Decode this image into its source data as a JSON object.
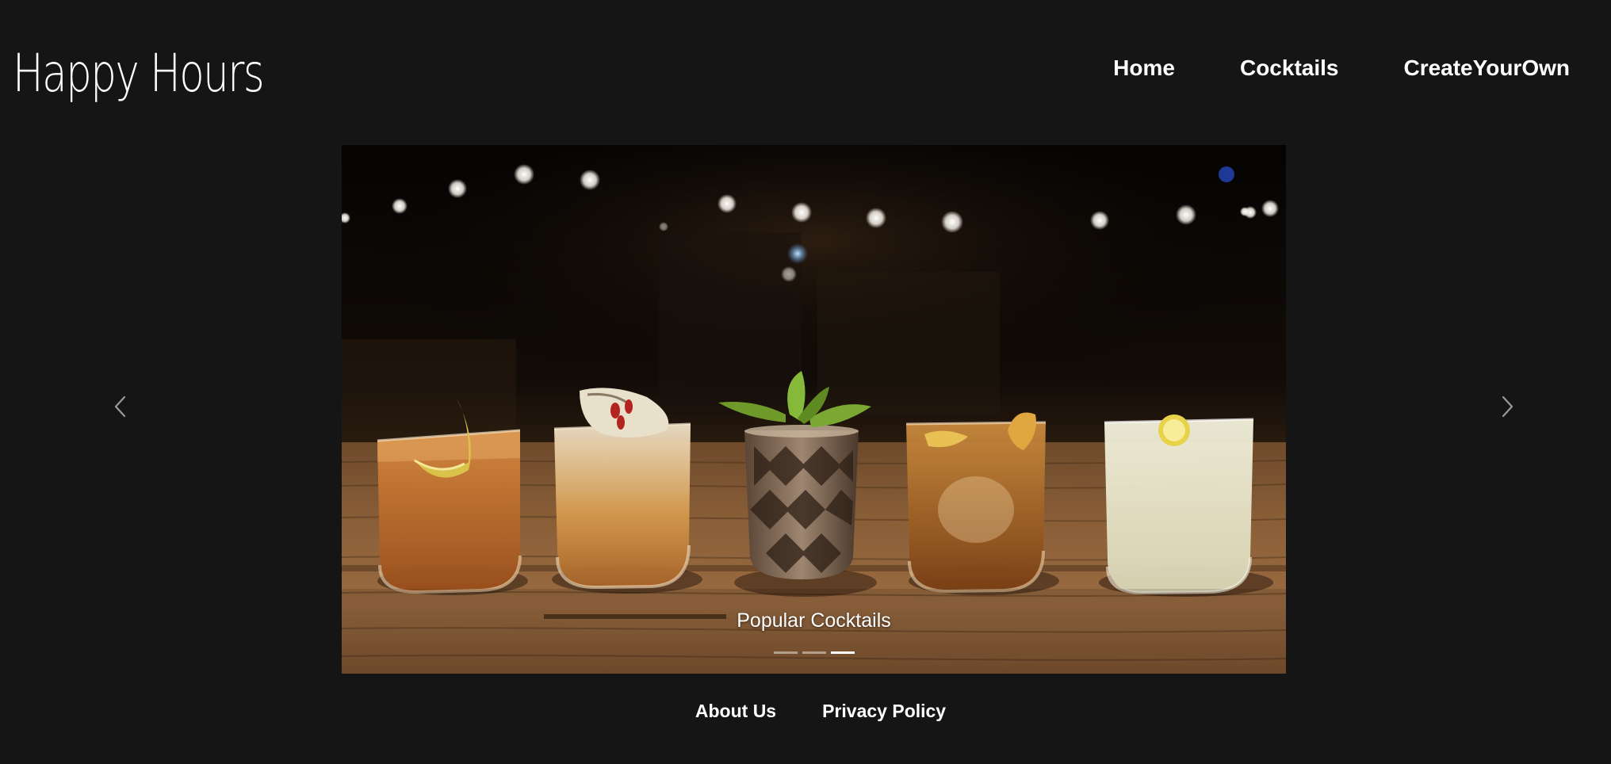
{
  "header": {
    "brand": "Happy Hours",
    "nav": [
      "Home",
      "Cocktails",
      "CreateYourOwn"
    ]
  },
  "carousel": {
    "caption": "Popular Cocktails",
    "indicator_count": 3,
    "active_index": 2,
    "prev_icon": "chevron-left-icon",
    "next_icon": "chevron-right-icon"
  },
  "footer": {
    "links": [
      "About Us",
      "Privacy Policy"
    ]
  },
  "colors": {
    "background": "#151515",
    "text": "#ffffff"
  }
}
